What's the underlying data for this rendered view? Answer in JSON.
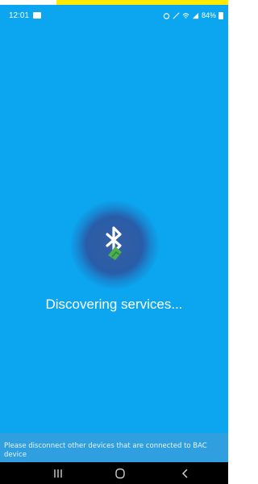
{
  "status_bar": {
    "time": "12:01",
    "battery": "84%",
    "icons": [
      "gallery-icon",
      "alarm-icon",
      "mute-icon",
      "wifi-icon",
      "signal-icon",
      "battery-icon"
    ]
  },
  "main": {
    "status_text": "Discovering services...",
    "icon": "bluetooth-icon"
  },
  "footer": {
    "notice": "Please disconnect other devices that are connected to BAC device"
  },
  "nav": {
    "recents": "recents-icon",
    "home": "home-icon",
    "back": "back-icon"
  },
  "colors": {
    "background": "#0ba6ef",
    "accent_bar": "#ffeb00",
    "spinner": "#3a5ca8",
    "bluetooth_green": "#4caf50",
    "nav_bar": "#000000"
  }
}
